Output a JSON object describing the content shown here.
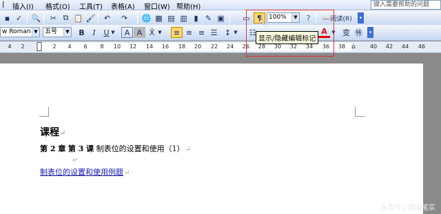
{
  "menubar": {
    "items": [
      "插入(I)",
      "格式(O)",
      "工具(T)",
      "表格(A)",
      "窗口(W)",
      "帮助(H)"
    ],
    "help_placeholder": "键入需要帮助的问题"
  },
  "toolbar1": {
    "zoom": "100%",
    "read_label": "阅读(R)"
  },
  "toolbar2": {
    "font_name": "w Roman",
    "font_size": "五号"
  },
  "ruler": {
    "numbers": [
      "4",
      "2",
      "2",
      "4",
      "6",
      "8",
      "10",
      "12",
      "14",
      "16",
      "18",
      "20",
      "22",
      "24",
      "26",
      "28",
      "30",
      "32",
      "34",
      "36",
      "38",
      "40",
      "42",
      "44",
      "46"
    ]
  },
  "tooltip": "显示/隐藏编辑标记",
  "document": {
    "heading": "课程",
    "line2_chapter": "第 2 章",
    "line2_lesson": "第 3 课",
    "line2_title": "制表位的设置和使用（1）",
    "link_text": "制表位的设置和使用例题"
  },
  "watermark": "头条号 / 校园笔实",
  "colors": {
    "font_color": "#e00000",
    "highlight_frame": "#e03030",
    "link": "#1a1ab0"
  }
}
